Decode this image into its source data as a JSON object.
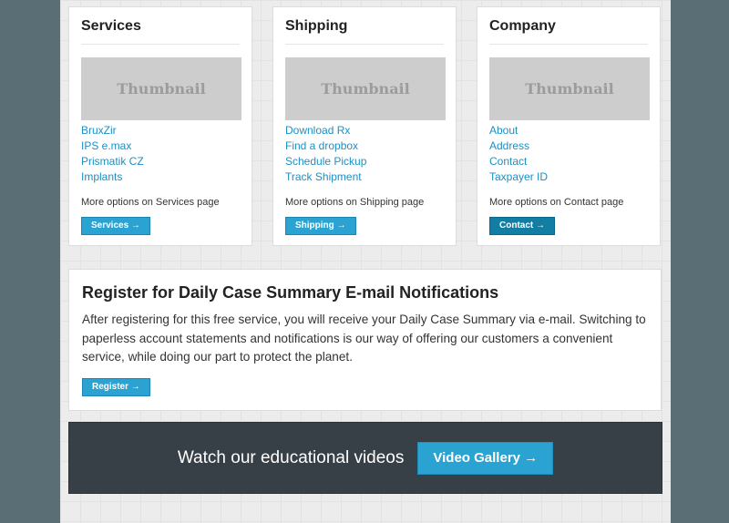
{
  "columns": [
    {
      "title": "Services",
      "thumbnail": "Thumbnail",
      "links": [
        "BruxZir",
        "IPS e.max",
        "Prismatik CZ",
        "Implants"
      ],
      "more_text": "More options on Services page",
      "button_label": "Services →"
    },
    {
      "title": "Shipping",
      "thumbnail": "Thumbnail",
      "links": [
        "Download Rx",
        "Find a dropbox",
        "Schedule Pickup",
        "Track Shipment"
      ],
      "more_text": "More options on Shipping page",
      "button_label": "Shipping →"
    },
    {
      "title": "Company",
      "thumbnail": "Thumbnail",
      "links": [
        "About",
        "Address",
        "Contact",
        "Taxpayer ID"
      ],
      "more_text": "More options on Contact page",
      "button_label": "Contact →"
    }
  ],
  "register": {
    "title": "Register for Daily Case Summary E-mail Notifications",
    "text": "After registering for this free service, you will receive your Daily Case Summary via e-mail. Switching to paperless account statements and notifications is our way of offering our customers a convenient service, while doing our part to protect the planet.",
    "button_label": "Register →"
  },
  "video": {
    "text": "Watch our educational videos",
    "button_label": "Video Gallery →"
  },
  "colors": {
    "link": "#1d8fc2",
    "button": "#2aa3d2",
    "button_active": "#137ea3",
    "video_bar": "#384047",
    "outer_bg": "#5a6e76"
  }
}
